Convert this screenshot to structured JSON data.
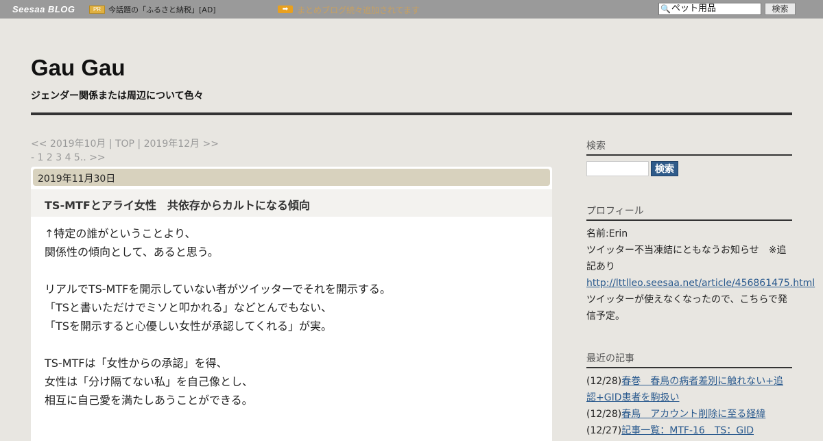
{
  "topbar": {
    "logo": "Seesaa BLOG",
    "pr_badge": "PR",
    "pr_text": "今話題の「ふるさと納税」[AD]",
    "arrow_badge": "➡",
    "matome_text": "まとめブログ続々追加されてます",
    "search_value": "ペット用品",
    "search_button": "検索"
  },
  "header": {
    "title": "Gau Gau",
    "subtitle": "ジェンダー関係または周辺について色々"
  },
  "nav": {
    "month_nav": "<< 2019年10月 | TOP | 2019年12月 >>",
    "page_nav": "- 1 2 3 4 5.. >>"
  },
  "post": {
    "date": "2019年11月30日",
    "title": "TS-MTFとアライ女性　共依存からカルトになる傾向",
    "lines": [
      "↑特定の誰がということより、",
      "関係性の傾向として、あると思う。",
      "",
      "リアルでTS-MTFを開示していない者がツイッターでそれを開示する。",
      "「TSと書いただけでミソと叩かれる」などとんでもない、",
      "「TSを開示すると心優しい女性が承認してくれる」が実。",
      "",
      "TS-MTFは「女性からの承認」を得、",
      "女性は「分け隔てない私」を自己像とし、",
      "相互に自己愛を満たしあうことができる。"
    ]
  },
  "sidebar": {
    "search_heading": "検索",
    "search_button": "検索",
    "profile_heading": "プロフィール",
    "profile_name": "名前:Erin",
    "profile_notice": "ツイッター不当凍結にともなうお知らせ　※追記あり",
    "profile_link": "http://lttlleo.seesaa.net/article/456861475.html",
    "profile_note": "ツイッターが使えなくなったので、こちらで発信予定。",
    "recent_heading": "最近の記事",
    "recent": [
      {
        "date": "(12/28)",
        "title": "春巻　春鳥の病者差別に触れない+追認+GID患者を駒扱い"
      },
      {
        "date": "(12/28)",
        "title": "春鳥　アカウント削除に至る経緯"
      },
      {
        "date": "(12/27)",
        "title": "記事一覧：MTF-16　TS：GID"
      }
    ]
  }
}
